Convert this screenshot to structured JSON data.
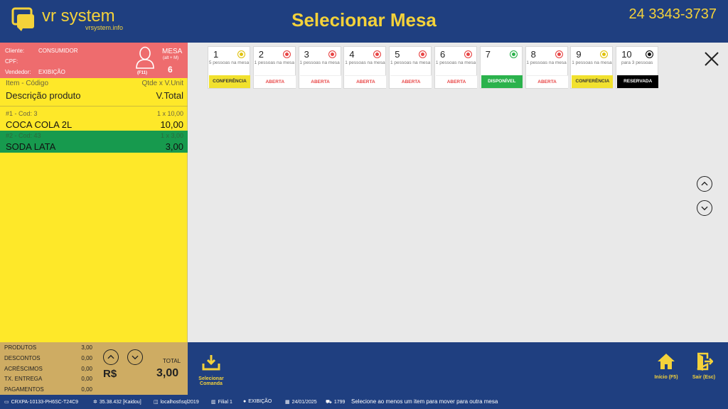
{
  "header": {
    "brand": "vr system",
    "brand_sub": "vrsystem.info",
    "title": "Selecionar Mesa",
    "phone": "24 3343-3737"
  },
  "customer": {
    "cliente_label": "Cliente:",
    "cliente_value": "CONSUMIDOR",
    "cpf_label": "CPF:",
    "vendedor_label": "Vendedor:",
    "vendedor_value": "EXIBIÇÃO",
    "f11": "(F11)",
    "mesa_label": "MESA",
    "mesa_shortcut": "(alt + M)",
    "mesa_number": "6"
  },
  "columns": {
    "item_code": "Item - Código",
    "qty_unit": "Qtde x V.Unit",
    "description": "Descrição produto",
    "total": "V.Total"
  },
  "items": [
    {
      "code": "#1 - Cod: 3",
      "qty": "1 x 10,00",
      "name": "COCA COLA 2L",
      "total": "10,00"
    },
    {
      "code": "#2 - Cod: 43",
      "qty": "1 x 3,00",
      "name": "SODA LATA",
      "total": "3,00"
    }
  ],
  "summary": {
    "rows": [
      {
        "label": "PRODUTOS",
        "value": "3,00"
      },
      {
        "label": "DESCONTOS",
        "value": "0,00"
      },
      {
        "label": "ACRÉSCIMOS",
        "value": "0,00"
      },
      {
        "label": "TX. ENTREGA",
        "value": "0,00"
      },
      {
        "label": "PAGAMENTOS",
        "value": "0,00"
      }
    ],
    "currency": "R$",
    "total_label": "TOTAL",
    "total_value": "3,00"
  },
  "tables": [
    {
      "number": "1",
      "desc": "5 pessoas na mesa",
      "status": "CONFERÊNCIA",
      "dot": "#e0c20e",
      "bg": "#f1e12e",
      "fg": "#333333"
    },
    {
      "number": "2",
      "desc": "1 pessoas na mesa",
      "status": "ABERTA",
      "dot": "#e84545",
      "bg": "#ffffff",
      "fg": "#e84545"
    },
    {
      "number": "3",
      "desc": "1 pessoas na mesa",
      "status": "ABERTA",
      "dot": "#e84545",
      "bg": "#ffffff",
      "fg": "#e84545"
    },
    {
      "number": "4",
      "desc": "1 pessoas na mesa",
      "status": "ABERTA",
      "dot": "#e84545",
      "bg": "#ffffff",
      "fg": "#e84545"
    },
    {
      "number": "5",
      "desc": "1 pessoas na mesa",
      "status": "ABERTA",
      "dot": "#e84545",
      "bg": "#ffffff",
      "fg": "#e84545"
    },
    {
      "number": "6",
      "desc": "1 pessoas na mesa",
      "status": "ABERTA",
      "dot": "#e84545",
      "bg": "#ffffff",
      "fg": "#e84545"
    },
    {
      "number": "7",
      "desc": "",
      "status": "DISPONÍVEL",
      "dot": "#2bb24c",
      "bg": "#2bb24c",
      "fg": "#ffffff"
    },
    {
      "number": "8",
      "desc": "1 pessoas na mesa",
      "status": "ABERTA",
      "dot": "#e84545",
      "bg": "#ffffff",
      "fg": "#e84545"
    },
    {
      "number": "9",
      "desc": "1 pessoas na mesa",
      "status": "CONFERÊNCIA",
      "dot": "#e0c20e",
      "bg": "#f1e12e",
      "fg": "#333333"
    },
    {
      "number": "10",
      "desc": "para 3 pessoas",
      "status": "RESERVADA",
      "dot": "#111111",
      "bg": "#000000",
      "fg": "#ffffff"
    }
  ],
  "toolbar": {
    "select_comanda": "Selecionar Comanda",
    "inicio": "Início (F5)",
    "sair": "Sair (Esc)"
  },
  "statusbar": {
    "machine": "CRXPA-10133-PH6SC-T24C9",
    "version": "35.38.432 [Kaidou]",
    "server": "localhost\\sql2019",
    "filial": "Filial 1",
    "user": "EXIBIÇÃO",
    "date": "24/01/2025",
    "cart": "1799",
    "message": "Selecione ao menos um item para mover para outra mesa"
  },
  "colors": {
    "header_blue": "#1f3f80",
    "accent_yellow": "#f4d23a",
    "customer_red": "#ee6c6e",
    "panel_yellow": "#fee829",
    "selected_green": "#179a4e",
    "summary_tan": "#ceac63"
  }
}
